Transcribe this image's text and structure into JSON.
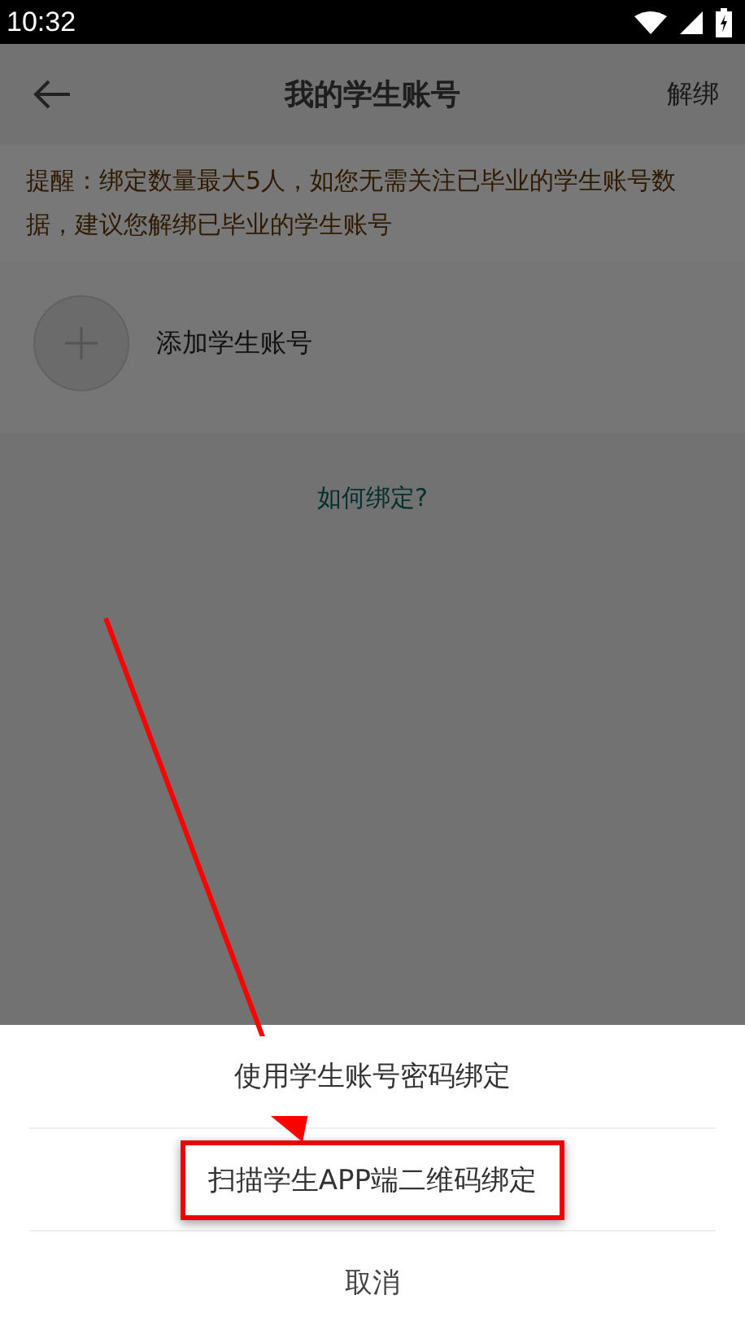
{
  "status_bar": {
    "time": "10:32"
  },
  "header": {
    "title": "我的学生账号",
    "action": "解绑"
  },
  "notice": "提醒：绑定数量最大5人，如您无需关注已毕业的学生账号数据，建议您解绑已毕业的学生账号",
  "add_account": {
    "label": "添加学生账号"
  },
  "help_link": "如何绑定?",
  "sheet": {
    "options": [
      {
        "label": "使用学生账号密码绑定",
        "kind": "option",
        "highlighted": false
      },
      {
        "label": "扫描学生APP端二维码绑定",
        "kind": "option",
        "highlighted": true
      },
      {
        "label": "取消",
        "kind": "cancel",
        "highlighted": false
      }
    ]
  },
  "annotation": {
    "arrow": true
  }
}
